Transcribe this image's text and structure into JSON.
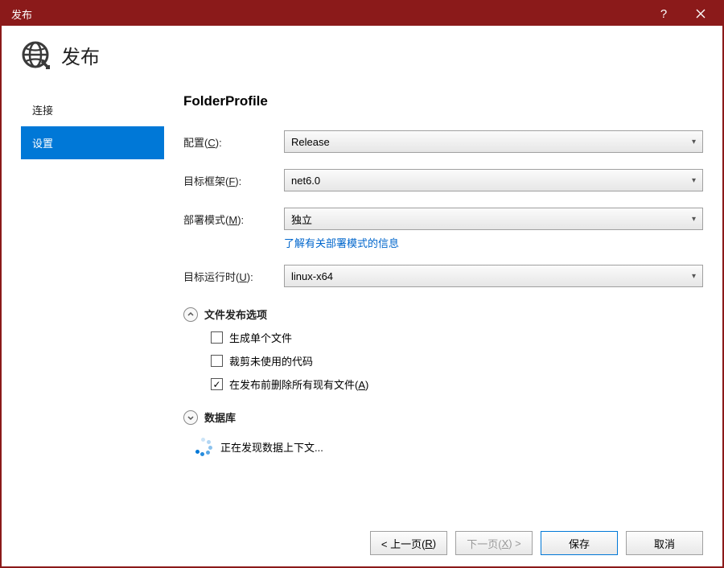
{
  "titlebar": {
    "title": "发布"
  },
  "header": {
    "title": "发布"
  },
  "nav": {
    "items": [
      {
        "label": "连接",
        "active": false
      },
      {
        "label": "设置",
        "active": true
      }
    ]
  },
  "profile": {
    "name": "FolderProfile"
  },
  "form": {
    "config_label": "配置(C):",
    "config_value": "Release",
    "framework_label": "目标框架(F):",
    "framework_value": "net6.0",
    "deploy_label": "部署模式(M):",
    "deploy_value": "独立",
    "deploy_hint": "了解有关部署模式的信息",
    "runtime_label": "目标运行时(U):",
    "runtime_value": "linux-x64"
  },
  "file_options": {
    "header": "文件发布选项",
    "single_file": "生成单个文件",
    "trim_unused": "裁剪未使用的代码",
    "delete_existing": "在发布前删除所有现有文件(A)"
  },
  "database": {
    "header": "数据库",
    "discovering": "正在发现数据上下文..."
  },
  "footer": {
    "prev": "< 上一页(R)",
    "next": "下一页(X) >",
    "save": "保存",
    "cancel": "取消"
  }
}
